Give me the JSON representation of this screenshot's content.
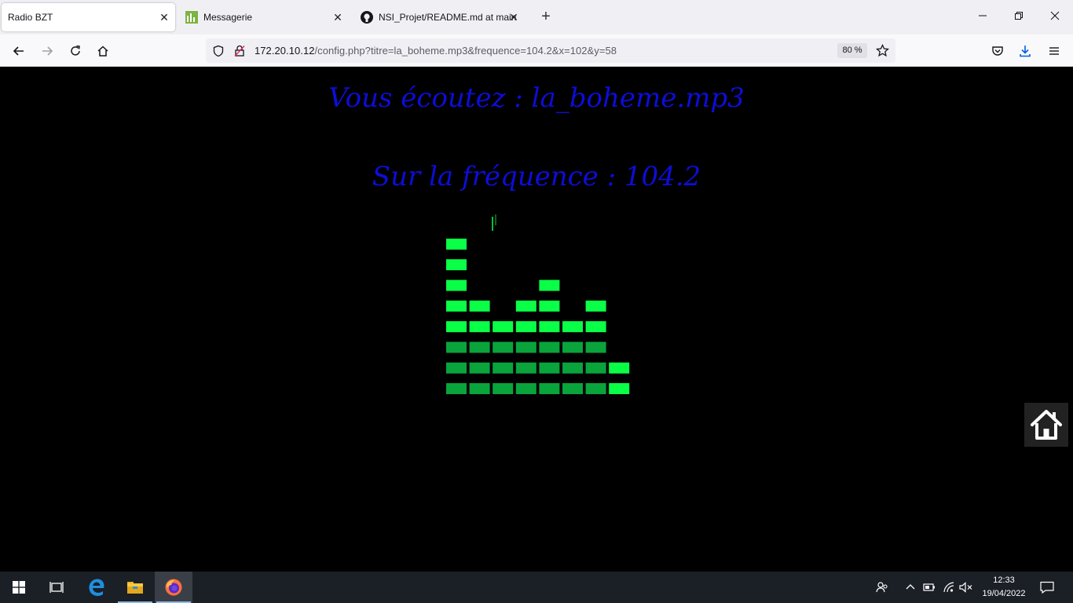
{
  "browser": {
    "tabs": [
      {
        "label": "Radio BZT",
        "active": true
      },
      {
        "label": "Messagerie",
        "active": false
      },
      {
        "label": "NSI_Projet/README.md at main",
        "active": false
      }
    ],
    "url": {
      "host": "172.20.10.12",
      "path": "/config.php?titre=la_boheme.mp3&frequence=104.2&x=102&y=58"
    },
    "zoom": "80 %"
  },
  "page": {
    "title": "Vous écoutez : la_boheme.mp3",
    "frequency": "Sur la fréquence : 104.2",
    "equalizer": {
      "bar_levels": [
        8,
        5,
        4,
        5,
        6,
        4,
        5,
        2
      ],
      "color_dim": "#09a43c",
      "color_bright": "#0aff47"
    }
  },
  "taskbar": {
    "time": "12:33",
    "date": "19/04/2022"
  },
  "colors": {
    "heading": "#0d0dd9",
    "page_bg": "#000000",
    "tabstrip_bg": "#f0f0f4",
    "taskbar_bg": "#1b1f26"
  }
}
